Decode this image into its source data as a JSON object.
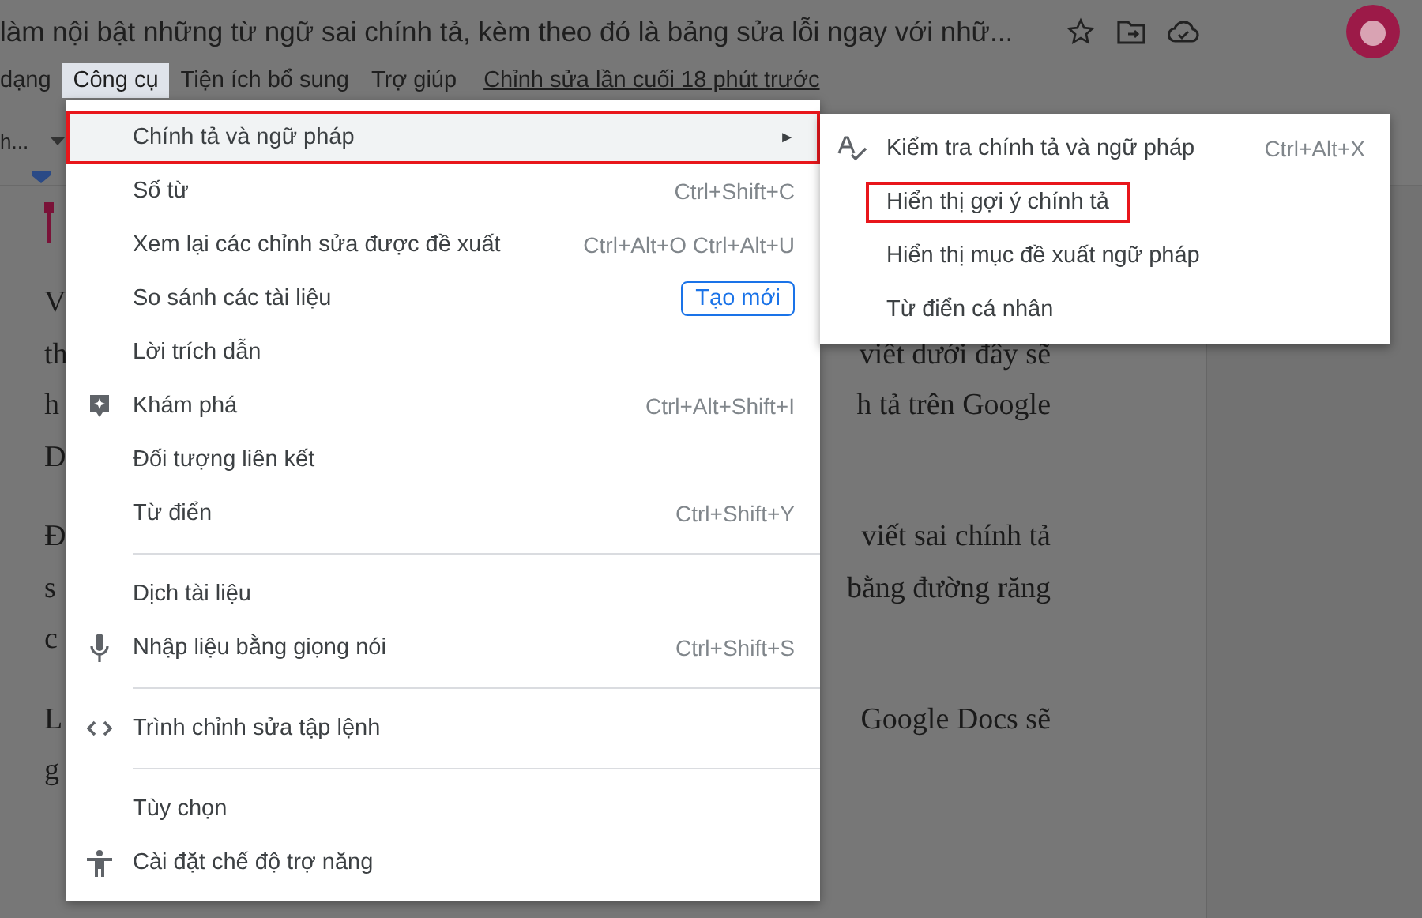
{
  "title": "làm nội bật những từ ngữ sai chính tả, kèm theo đó là bảng sửa lỗi ngay với nhữ...",
  "menubar": [
    {
      "label": "dạng",
      "selected": false
    },
    {
      "label": "Công cụ",
      "selected": true
    },
    {
      "label": "Tiện ích bổ sung",
      "selected": false
    },
    {
      "label": "Trợ giúp",
      "selected": false
    }
  ],
  "last_edit": "Chỉnh sửa lần cuối 18 phút trước",
  "toolbar": {
    "font_field": "h..."
  },
  "document": {
    "paragraphs": [
      [
        {
          "left": "V"
        },
        {
          "left": "th",
          "right": "viết dưới đây sẽ"
        },
        {
          "left": "h",
          "right": "h tả trên Google"
        },
        {
          "left": "D"
        }
      ],
      [
        {
          "left": "Đ",
          "right": "viết sai chính tả"
        },
        {
          "left": "s",
          "right": "bằng đường răng"
        },
        {
          "left": "c"
        }
      ],
      [
        {
          "left": "L",
          "right": "Google Docs sẽ"
        },
        {
          "left": "g"
        }
      ]
    ]
  },
  "menu": {
    "items": [
      {
        "kind": "submenu",
        "label": "Chính tả và ngữ pháp",
        "arrow": "►",
        "selected": true,
        "outlined": true
      },
      {
        "kind": "item",
        "label": "Số từ",
        "shortcut": "Ctrl+Shift+C",
        "selected": false,
        "outlined": false
      },
      {
        "kind": "item",
        "label": "Xem lại các chỉnh sửa được đề xuất",
        "shortcut": "Ctrl+Alt+O Ctrl+Alt+U",
        "selected": false,
        "outlined": false
      },
      {
        "kind": "button",
        "label": "So sánh các tài liệu",
        "button": "Tạo mới",
        "selected": false,
        "outlined": false
      },
      {
        "kind": "item",
        "label": "Lời trích dẫn",
        "selected": false,
        "outlined": false
      },
      {
        "kind": "item",
        "label": "Khám phá",
        "shortcut": "Ctrl+Alt+Shift+I",
        "selected": false,
        "outlined": false
      },
      {
        "kind": "item",
        "label": "Đối tượng liên kết",
        "selected": false,
        "outlined": false
      },
      {
        "kind": "item",
        "label": "Từ điển",
        "shortcut": "Ctrl+Shift+Y",
        "selected": false,
        "outlined": false
      },
      {
        "kind": "divider"
      },
      {
        "kind": "item",
        "label": "Dịch tài liệu",
        "selected": false,
        "outlined": false
      },
      {
        "kind": "item",
        "label": "Nhập liệu bằng giọng nói",
        "shortcut": "Ctrl+Shift+S",
        "selected": false,
        "outlined": false
      },
      {
        "kind": "divider"
      },
      {
        "kind": "item",
        "label": "Trình chỉnh sửa tập lệnh",
        "selected": false,
        "outlined": false
      },
      {
        "kind": "divider"
      },
      {
        "kind": "item",
        "label": "Tùy chọn",
        "selected": false,
        "outlined": false
      },
      {
        "kind": "item",
        "label": "Cài đặt chế độ trợ năng",
        "selected": false,
        "outlined": false
      }
    ]
  },
  "submenu": {
    "items": [
      {
        "label": "Kiểm tra chính tả và ngữ pháp",
        "shortcut": "Ctrl+Alt+X",
        "selected": false,
        "outlined": false
      },
      {
        "label": "Hiển thị gợi ý chính tả",
        "selected": false,
        "outlined": true
      },
      {
        "label": "Hiển thị mục đề xuất ngữ pháp",
        "selected": false,
        "outlined": false
      },
      {
        "label": "Từ điển cá nhân",
        "selected": false,
        "outlined": false
      }
    ]
  }
}
